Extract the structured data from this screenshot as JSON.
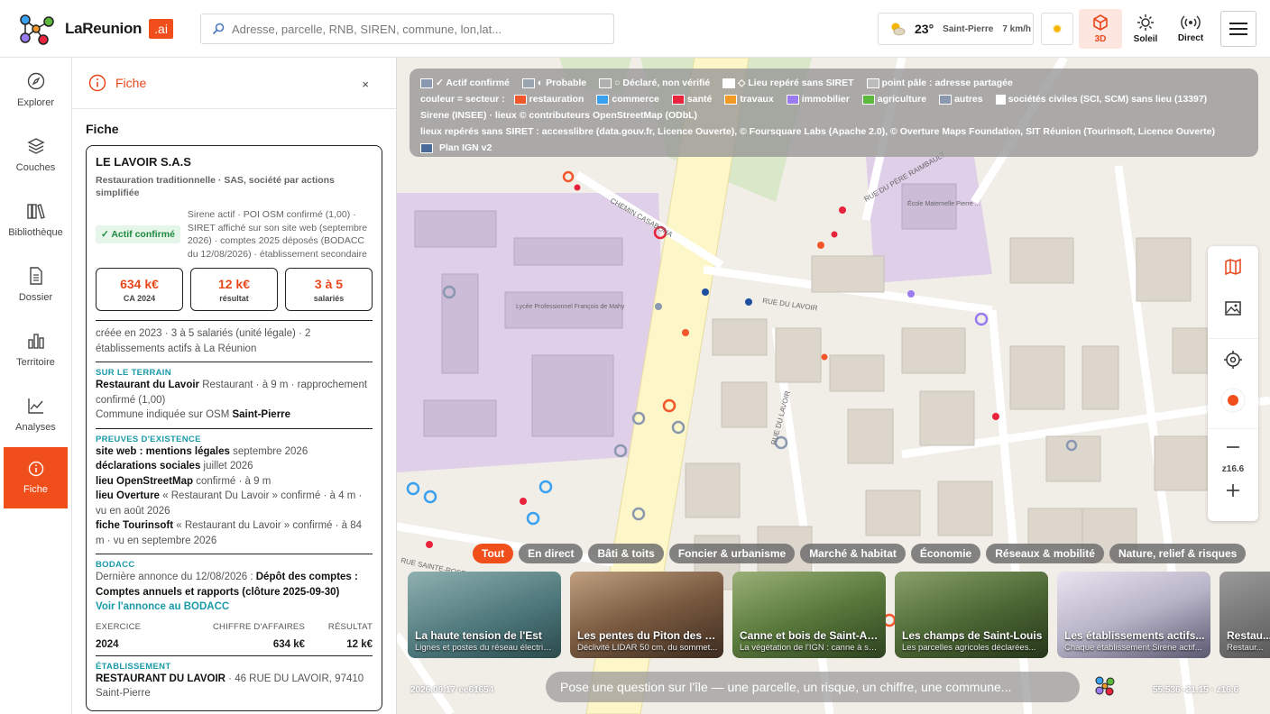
{
  "app": {
    "name": "LaReunion",
    "badge": ".ai"
  },
  "search": {
    "placeholder": "Adresse, parcelle, RNB, SIREN, commune, lon,lat..."
  },
  "weather": {
    "temp": "23°",
    "city": "Saint-Pierre",
    "wind": "7 km/h"
  },
  "toolbar": {
    "btn3d": "3D",
    "soleil": "Soleil",
    "direct": "Direct"
  },
  "nav": [
    {
      "label": "Explorer",
      "icon": "compass-icon"
    },
    {
      "label": "Couches",
      "icon": "layers-icon"
    },
    {
      "label": "Bibliothèque",
      "icon": "library-icon"
    },
    {
      "label": "Dossier",
      "icon": "document-icon"
    },
    {
      "label": "Territoire",
      "icon": "bar-chart-icon"
    },
    {
      "label": "Analyses",
      "icon": "line-chart-icon"
    },
    {
      "label": "Fiche",
      "icon": "info-icon"
    }
  ],
  "panel": {
    "header": "Fiche",
    "close": "×",
    "section": "Fiche",
    "company": "LE LAVOIR S.A.S",
    "activity": "Restauration traditionnelle · SAS, société par actions simplifiée",
    "status_badge": "✓ Actif confirmé",
    "status_text": "Sirene actif · POI OSM confirmé (1,00) · SIRET affiché sur son site web (septembre 2026) · comptes 2025 déposés (BODACC du 12/08/2026) · établissement secondaire",
    "kpis": [
      {
        "value": "634 k€",
        "label": "CA 2024"
      },
      {
        "value": "12 k€",
        "label": "résultat"
      },
      {
        "value": "3 à 5",
        "label": "salariés"
      }
    ],
    "summary": "créée en 2023 · 3 à 5 salariés (unité légale) · 2 établissements actifs à La Réunion",
    "terrain": {
      "title": "SUR LE TERRAIN",
      "name": "Restaurant du Lavoir",
      "detail": " Restaurant · à 9 m · rapprochement confirmé (1,00)",
      "commune_label": "Commune indiquée sur OSM ",
      "commune": "Saint-Pierre"
    },
    "preuves": {
      "title": "PREUVES D'EXISTENCE",
      "items": [
        {
          "k": "site web : mentions légales",
          "v": " septembre 2026"
        },
        {
          "k": "déclarations sociales",
          "v": " juillet 2026"
        },
        {
          "k": "lieu OpenStreetMap",
          "v": " confirmé · à 9 m"
        },
        {
          "k": "lieu Overture",
          "v": " « Restaurant Du Lavoir » confirmé · à 4 m · vu en août 2026"
        },
        {
          "k": "fiche Tourinsoft",
          "v": " « Restaurant du Lavoir » confirmé · à 84 m · vu en septembre 2026"
        }
      ]
    },
    "bodacc": {
      "title": "BODACC",
      "text": "Dernière annonce du 12/08/2026 : ",
      "bold": "Dépôt des comptes : Comptes annuels et rapports (clôture 2025-09-30)",
      "link": "Voir l'annonce au BODACC",
      "cols": [
        "EXERCICE",
        "CHIFFRE D'AFFAIRES",
        "RÉSULTAT"
      ],
      "row": [
        "2024",
        "634 k€",
        "12 k€"
      ]
    },
    "etab": {
      "title": "ÉTABLISSEMENT",
      "name": "RESTAURANT DU LAVOIR",
      "addr": " · 46 RUE DU LAVOIR, 97410 Saint-Pierre"
    }
  },
  "legend": {
    "row1": [
      {
        "label": "✓ Actif confirmé",
        "color": "#8a98b0"
      },
      {
        "label": "◐ Probable",
        "color": "#9aa4b0"
      },
      {
        "label": "○ Déclaré, non vérifié",
        "color": "#b0b0b0"
      },
      {
        "label": "◇ Lieu repéré sans SIRET",
        "color": "#ffffff"
      },
      {
        "label": "point pâle : adresse partagée",
        "color": "#bcbcbc"
      }
    ],
    "sector_label": "couleur = secteur :",
    "sectors": [
      {
        "label": "restauration",
        "color": "#f2572b"
      },
      {
        "label": "commerce",
        "color": "#3aa0f0"
      },
      {
        "label": "santé",
        "color": "#e8243c"
      },
      {
        "label": "travaux",
        "color": "#f29a26"
      },
      {
        "label": "immobilier",
        "color": "#9b7bf0"
      },
      {
        "label": "agriculture",
        "color": "#5cb83c"
      },
      {
        "label": "autres",
        "color": "#8a98b0"
      },
      {
        "label": "sociétés civiles (SCI, SCM) sans lieu (13397)",
        "color": "#ffffff"
      }
    ],
    "src1": "Sirene (INSEE) · lieux © contributeurs OpenStreetMap (ODbL)",
    "src2": "lieux repérés sans SIRET : accesslibre (data.gouv.fr, Licence Ouverte), © Foursquare Labs (Apache 2.0), © Overture Maps Foundation, SIT Réunion (Tourinsoft, Licence Ouverte)",
    "plan": "Plan IGN v2"
  },
  "map_labels": [
    {
      "text": "CHEMIN CASABONA"
    },
    {
      "text": "RUE DU PÈRE RAIMBAULT"
    },
    {
      "text": "École Maternelle Pierre ..."
    },
    {
      "text": "RUE DU LAVOIR"
    },
    {
      "text": "Lycée Professionnel François de Mahy"
    },
    {
      "text": "RUE DU LAVOIR"
    },
    {
      "text": "RUE SAINTE-ROSE"
    }
  ],
  "zoom": "z16.6",
  "chips": [
    "Tout",
    "En direct",
    "Bâti & toits",
    "Foncier & urbanisme",
    "Marché & habitat",
    "Économie",
    "Réseaux & mobilité",
    "Nature, relief & risques"
  ],
  "stories": [
    {
      "title": "La haute tension de l'Est",
      "desc": "Lignes et postes du réseau électrique...",
      "bg": "#5c8a8e"
    },
    {
      "title": "Les pentes du Piton des Neiges",
      "desc": "Déclivité LIDAR 50 cm, du sommet...",
      "bg": "#7a5a40"
    },
    {
      "title": "Canne et bois de Saint-André",
      "desc": "La végétation de l'IGN : canne à sucre...",
      "bg": "#5a7a3c"
    },
    {
      "title": "Les champs de Saint-Louis",
      "desc": "Les parcelles agricoles déclarées...",
      "bg": "#4e6a36"
    },
    {
      "title": "Les établissements actifs...",
      "desc": "Chaque établissement Sirene actif...",
      "bg": "#b8b4c8"
    },
    {
      "title": "Restau...",
      "desc": "Restaur...",
      "bg": "#6a6a6a"
    }
  ],
  "ask": {
    "placeholder": "Pose une question sur l'île — une parcelle, un risque, un chiffre, une commune..."
  },
  "footer": {
    "left": "2026.09.17·ee61654",
    "right": "55.536 -21.15  ·  z16.6"
  }
}
